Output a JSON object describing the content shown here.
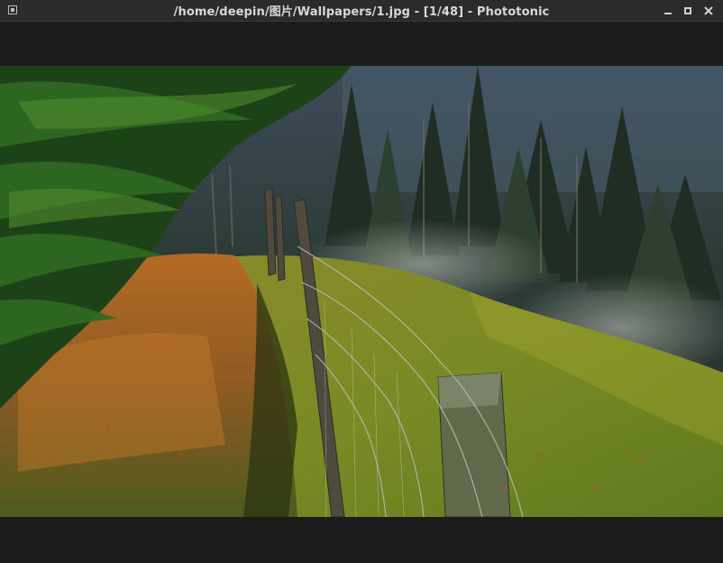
{
  "window": {
    "title": "/home/deepin/图片/Wallpapers/1.jpg - [1/48] - Phototonic",
    "app_icon": "phototonic-app-icon",
    "controls": {
      "minimize_icon": "minimize-icon",
      "maximize_icon": "maximize-icon",
      "close_icon": "close-icon"
    }
  },
  "image": {
    "file_name": "1.jpg",
    "position": "1/48",
    "subject": "forest-hillside-fence-photo"
  },
  "colors": {
    "titlebar": "#2b2b2d",
    "background": "#1b1b1c",
    "title_text": "#d8d8d8"
  }
}
